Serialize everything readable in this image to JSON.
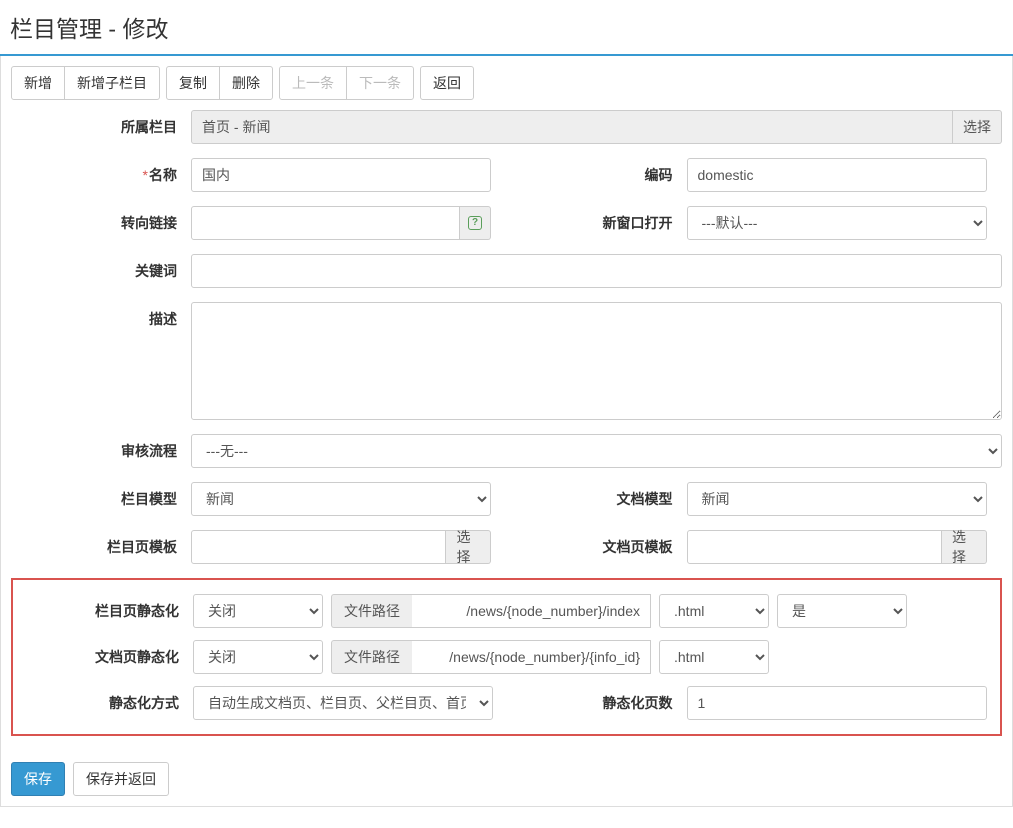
{
  "page_title": "栏目管理 - 修改",
  "toolbar": {
    "add": "新增",
    "add_sub": "新增子栏目",
    "copy": "复制",
    "delete": "删除",
    "prev": "上一条",
    "next": "下一条",
    "back": "返回"
  },
  "labels": {
    "parent": "所属栏目",
    "name": "名称",
    "code": "编码",
    "redirect": "转向链接",
    "new_window": "新窗口打开",
    "keywords": "关键词",
    "description": "描述",
    "workflow": "审核流程",
    "node_model": "栏目模型",
    "doc_model": "文档模型",
    "node_tpl": "栏目页模板",
    "doc_tpl": "文档页模板",
    "node_static": "栏目页静态化",
    "doc_static": "文档页静态化",
    "static_method": "静态化方式",
    "static_pages": "静态化页数",
    "file_path": "文件路径",
    "select": "选择"
  },
  "values": {
    "parent": "首页 - 新闻",
    "name": "国内",
    "code": "domestic",
    "redirect": "",
    "new_window": "---默认---",
    "keywords": "",
    "description": "",
    "workflow": "---无---",
    "node_model": "新闻",
    "doc_model": "新闻",
    "node_tpl": "",
    "doc_tpl": "",
    "node_static_enable": "关闭",
    "node_static_path": "/news/{node_number}/index",
    "node_static_ext": ".html",
    "node_static_def": "是",
    "doc_static_enable": "关闭",
    "doc_static_path": "/news/{node_number}/{info_id}",
    "doc_static_ext": ".html",
    "static_method": "自动生成文档页、栏目页、父栏目页、首页",
    "static_pages": "1"
  },
  "footer": {
    "save": "保存",
    "save_back": "保存并返回"
  }
}
